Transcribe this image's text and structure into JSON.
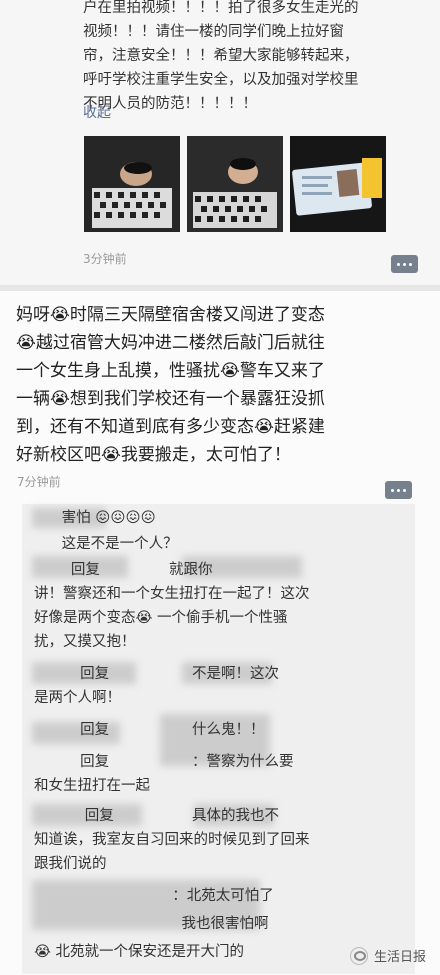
{
  "post1": {
    "text": "户在里拍视频！！！！拍了很多女生走光的\n视频！！！请住一楼的同学们晚上拉好窗\n帘，注意安全！！！希望大家能够转起来，\n呼吁学校注重学生安全，以及加强对学校里\n不明人员的防范！！！！！",
    "collapse_label": "收起",
    "time": "3分钟前"
  },
  "post2": {
    "text": "妈呀😭时隔三天隔壁宿舍楼又闯进了变态\n😭越过宿管大妈冲进二楼然后敲门后就往\n一个女生身上乱摸，性骚扰😭警车又来了\n一辆😭想到我们学校还有一个暴露狂没抓\n到，还有不知道到底有多少变态😭赶紧建\n好新校区吧😭我要搬走，太可怕了！",
    "time": "7分钟前"
  },
  "comments": [
    {
      "text": "      害怕 😖😖😖😖"
    },
    {
      "text": "      这是不是一个人？"
    },
    {
      "text": "        回复               就跟你"
    },
    {
      "text": "讲！警察还和一个女生扭打在一起了！这次"
    },
    {
      "text": "好像是两个变态😭 一个偷手机一个性骚"
    },
    {
      "text": "扰，又摸又抱！"
    },
    {
      "text": "          回复                  不是啊！这次"
    },
    {
      "text": "是两个人啊！"
    },
    {
      "text": "          回复                  什么鬼！！"
    },
    {
      "text": "          回复                  ：警察为什么要"
    },
    {
      "text": "和女生扭打在一起"
    },
    {
      "text": "           回复                 具体的我也不"
    },
    {
      "text": "知道诶，我室友自习回来的时候见到了回来"
    },
    {
      "text": "跟我们说的"
    },
    {
      "text": "                              ：北苑太可怕了"
    },
    {
      "text": "                                我也很害怕啊"
    },
    {
      "text": "😭 北苑就一个保安还是开大门的"
    }
  ],
  "watermark": "生活日报"
}
